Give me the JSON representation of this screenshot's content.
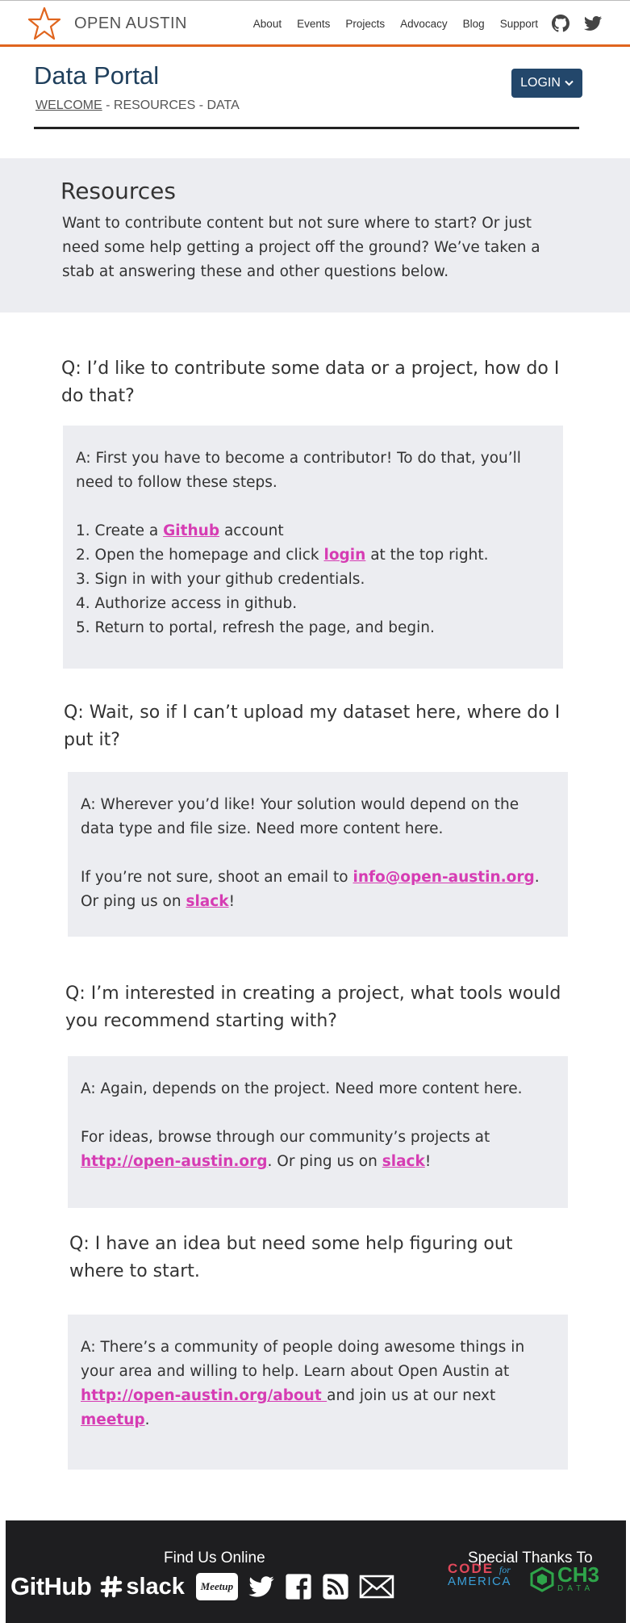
{
  "header": {
    "brand": "OPEN AUSTIN",
    "nav": [
      "About",
      "Events",
      "Projects",
      "Advocacy",
      "Blog",
      "Support"
    ],
    "accent_color": "#e0651e"
  },
  "page": {
    "title": "Data Portal",
    "breadcrumb": {
      "welcome": "WELCOME",
      "rest": " - RESOURCES - DATA"
    },
    "login_label": "LOGIN"
  },
  "hero": {
    "title": "Resources",
    "text": "Want to contribute content but not sure where to start? Or just need some help getting a project off the ground? We’ve taken a stab at answering these and other questions below."
  },
  "faq": {
    "q1": "Q: I’d like to contribute some data or a project, how do I do that?",
    "a1": {
      "intro": "A: First you have to become a contributor! To do that, you’ll need to follow these steps.",
      "s1_pre": "1. Create a ",
      "s1_link": "Github",
      "s1_post": " account",
      "s2_pre": "2. Open the homepage and click ",
      "s2_link": "login",
      "s2_post": " at the top right.",
      "s3": "3. Sign in with your github credentials.",
      "s4": "4. Authorize access in github.",
      "s5": "5. Return to portal, refresh the page, and begin."
    },
    "q2": "Q: Wait, so if I can’t upload my dataset here, where do I put it?",
    "a2": {
      "p1": "A: Wherever you’d like! Your solution would depend on the data type and file size. Need more content here.",
      "p2_pre": "If you’re not sure, shoot an email to ",
      "p2_link": "info@open-austin.org",
      "p2_mid": ". Or ping us on ",
      "p2_link2": "slack",
      "p2_post": "!"
    },
    "q3": "Q: I’m interested in creating a project, what tools would you recommend starting with?",
    "a3": {
      "p1": "A: Again, depends on the project. Need more content here.",
      "p2_pre": "For ideas, browse through our community’s projects at ",
      "p2_link": "http://open-austin.org",
      "p2_mid": ". Or ping us on ",
      "p2_link2": "slack",
      "p2_post": "!"
    },
    "q4": "Q: I have an idea but need some help figuring out where to start.",
    "a4": {
      "p1_pre": "A: There’s a community of people doing awesome things in your area and willing to help. Learn about Open Austin at ",
      "p1_link": "http://open-austin.org/about ",
      "p1_mid": "and join us at our next ",
      "p1_link2": "meetup",
      "p1_post": "."
    },
    "link_color": "#d63cb3"
  },
  "footer": {
    "find_us": "Find Us Online",
    "thanks": "Special Thanks To",
    "github": "GitHub",
    "slack": "slack",
    "meetup": "Meetup",
    "cfa_top": "CODE",
    "cfa_for": "for",
    "cfa_bottom": "AMERICA",
    "ch3_big": "CH3",
    "ch3_small": "DATA"
  }
}
